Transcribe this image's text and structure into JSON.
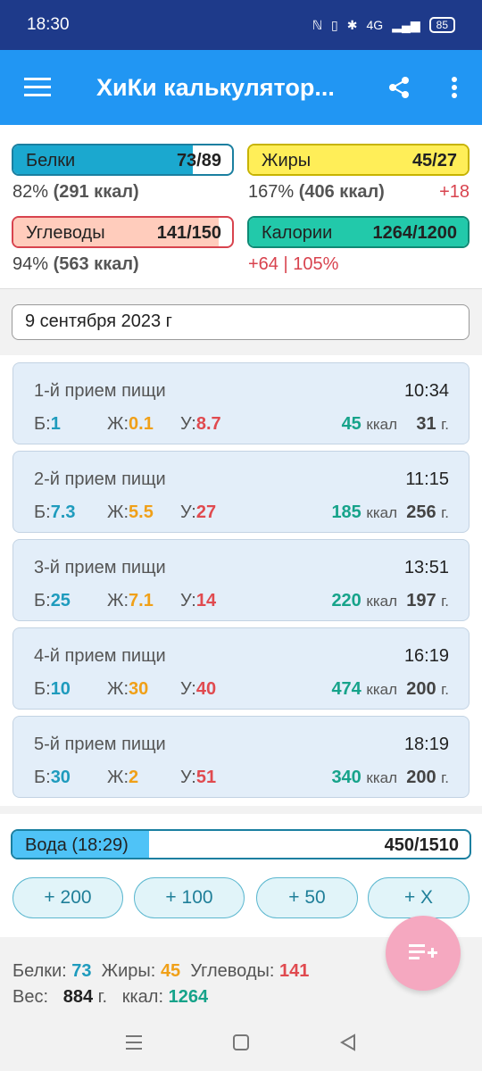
{
  "status": {
    "time": "18:30",
    "battery": "85",
    "network": "4G"
  },
  "appbar": {
    "title": "ХиКи калькулятор..."
  },
  "summary": {
    "protein": {
      "label": "Белки",
      "value": "73/89",
      "fill": 0.82,
      "detail_pct": "82%",
      "detail_kcal": "(291 ккал)"
    },
    "fat": {
      "label": "Жиры",
      "value": "45/27",
      "fill": 1.0,
      "detail_pct": "167%",
      "detail_kcal": "(406 ккал)",
      "over": "+18"
    },
    "carbs": {
      "label": "Углеводы",
      "value": "141/150",
      "fill": 0.94,
      "detail_pct": "94%",
      "detail_kcal": "(563 ккал)"
    },
    "calories": {
      "label": "Калории",
      "value": "1264/1200",
      "fill": 1.0,
      "detail": "+64 | 105%"
    }
  },
  "date": {
    "value": "9 сентября 2023 г"
  },
  "meal_labels": {
    "b": "Б:",
    "f": "Ж:",
    "c": "У:",
    "kcal": "ккал",
    "g": "г."
  },
  "meals": [
    {
      "name": "1-й прием пищи",
      "time": "10:34",
      "b": "1",
      "f": "0.1",
      "c": "8.7",
      "kcal": "45",
      "grams": "31"
    },
    {
      "name": "2-й прием пищи",
      "time": "11:15",
      "b": "7.3",
      "f": "5.5",
      "c": "27",
      "kcal": "185",
      "grams": "256"
    },
    {
      "name": "3-й прием пищи",
      "time": "13:51",
      "b": "25",
      "f": "7.1",
      "c": "14",
      "kcal": "220",
      "grams": "197"
    },
    {
      "name": "4-й прием пищи",
      "time": "16:19",
      "b": "10",
      "f": "30",
      "c": "40",
      "kcal": "474",
      "grams": "200"
    },
    {
      "name": "5-й прием пищи",
      "time": "18:19",
      "b": "30",
      "f": "2",
      "c": "51",
      "kcal": "340",
      "grams": "200"
    }
  ],
  "water": {
    "label": "Вода (18:29)",
    "value": "450/1510",
    "fill": 0.298,
    "buttons": [
      "+ 200",
      "+ 100",
      "+ 50",
      "+ X"
    ]
  },
  "totals": {
    "protein_label": "Белки:",
    "protein": "73",
    "fat_label": "Жиры:",
    "fat": "45",
    "carbs_label": "Углеводы:",
    "carbs": "141",
    "weight_label": "Вес:",
    "weight": "884",
    "weight_unit": "г.",
    "kcal_label": "ккал:",
    "kcal": "1264"
  },
  "colors": {
    "appbar": "#2196f3",
    "statusbar": "#1e3a8a",
    "protein": "#1e9bbd",
    "fat": "#f0a018",
    "carbs": "#e04a4f",
    "kcal": "#16a38a",
    "fab": "#f5a8c0"
  },
  "icons": [
    "hamburger-icon",
    "share-icon",
    "more-vert-icon",
    "playlist-add-icon",
    "nav-recents-icon",
    "nav-home-icon",
    "nav-back-icon"
  ]
}
